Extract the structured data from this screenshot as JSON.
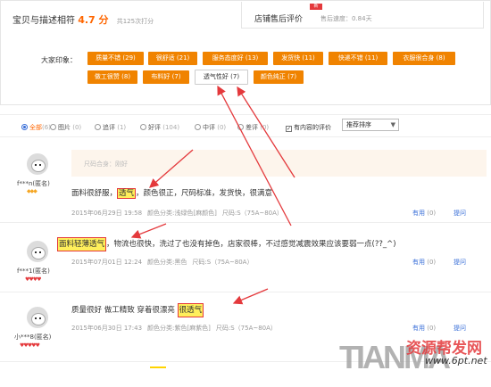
{
  "rating": {
    "label": "宝贝与描述相符",
    "score": "4.7 分",
    "count": "共125次打分"
  },
  "shop_service": {
    "label": "店铺售后评价",
    "speed": "售后速度：0.84天",
    "badge": "新"
  },
  "impressions": {
    "label": "大家印象：",
    "tags": [
      "质量不错 (29)",
      "很舒适 (21)",
      "服务态度好 (13)",
      "发货快 (11)",
      "快递不错 (11)",
      "衣服很合身 (8)",
      "做工很赞 (8)",
      "布料好 (7)",
      "透气性好 (7)",
      "颜色纯正 (7)"
    ]
  },
  "filter": {
    "all": "全部",
    "all_count": "(6)",
    "pic": "图片",
    "pic_count": "(0)",
    "append": "追评",
    "append_count": "(1)",
    "good": "好评",
    "good_count": "(104)",
    "mid": "中评",
    "mid_count": "(0)",
    "bad": "差评",
    "bad_count": "(0)",
    "has_content": "有内容的评价",
    "checkbox_mark": "✓",
    "sort": "推荐排序",
    "sort_arrow": "▼"
  },
  "reviews": [
    {
      "user": "f***n(匿名)",
      "level": "◆◆◆",
      "size_fit": "尺码合身：刚好",
      "text_before": "面料很舒服，",
      "text_hl": "透气",
      "text_after": "，颜色很正，尺码标准，发货快，很满意",
      "date": "2015年06月29日 19:58",
      "color": "颜色分类:浅绿色[麻颜色]",
      "size": "尺码:S（75A~80A）",
      "useful": "有用",
      "useful_count": "(0)",
      "reply": "提问"
    },
    {
      "user": "f***1(匿名)",
      "level": "♥♥♥♥",
      "text_hl": "面料轻薄透气",
      "text_after": "，物流也很快，洗过了也没有掉色，店家很棒，不过感觉减震效果应该要弱一点(??_^)",
      "date": "2015年07月01日 12:24",
      "color": "颜色分类:黑色",
      "size": "尺码:S（75A~80A）",
      "useful": "有用",
      "useful_count": "(0)",
      "reply": "提问"
    },
    {
      "user": "小***8(匿名)",
      "level": "♥♥♥♥♥",
      "text_before": "质量很好 做工精致 穿着很漂亮 ",
      "text_hl": "很透气",
      "date": "2015年06月30日 17:43",
      "color": "颜色分类:紫色[麻紫色]",
      "size": "尺码:S（75A~80A）",
      "useful": "有用",
      "useful_count": "(0)",
      "reply": "提问"
    }
  ],
  "watermark": {
    "brand": "TIANMA",
    "cn": "资源帮发网",
    "url": "www.6pt.net"
  }
}
